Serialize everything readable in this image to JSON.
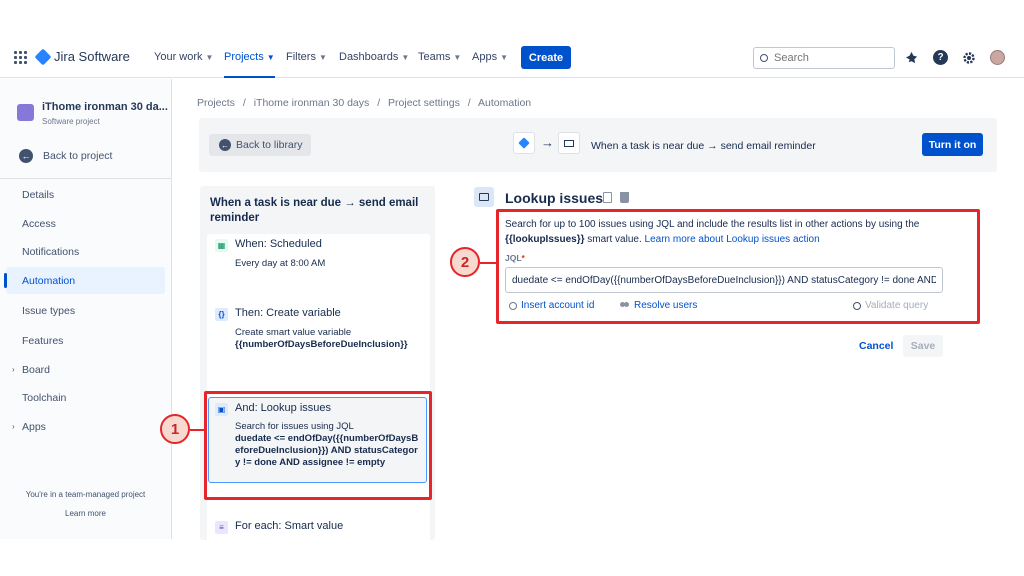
{
  "topnav": {
    "logo": "Jira Software",
    "items": [
      {
        "label": "Your work"
      },
      {
        "label": "Projects"
      },
      {
        "label": "Filters"
      },
      {
        "label": "Dashboards"
      },
      {
        "label": "Teams"
      },
      {
        "label": "Apps"
      }
    ],
    "create_label": "Create",
    "search_placeholder": "Search"
  },
  "sidebar": {
    "project_name": "iThome ironman 30 da...",
    "project_type": "Software project",
    "back_label": "Back to project",
    "items": [
      {
        "label": "Details"
      },
      {
        "label": "Access"
      },
      {
        "label": "Notifications"
      },
      {
        "label": "Automation"
      },
      {
        "label": "Issue types"
      },
      {
        "label": "Features"
      },
      {
        "label": "Board"
      },
      {
        "label": "Toolchain"
      },
      {
        "label": "Apps"
      }
    ],
    "footer_text": "You're in a team-managed project",
    "footer_link": "Learn more"
  },
  "breadcrumb": {
    "items": [
      "Projects",
      "/",
      "iThome ironman 30 days",
      "/",
      "Project settings",
      "/",
      "Automation"
    ]
  },
  "toolbar": {
    "back_label": "Back to library",
    "rule_title": "When a task is near due → send email reminder",
    "turn_on_label": "Turn it on"
  },
  "rule": {
    "title": "When a task is near due → send email reminder",
    "components": [
      {
        "head": "When: Scheduled",
        "desc": "Every day at 8:00 AM"
      },
      {
        "head": "Then: Create variable",
        "desc": "Create smart value variable",
        "desc_bold": "{{numberOfDaysBeforeDueInclusion}}"
      },
      {
        "head": "And: Lookup issues",
        "desc": "Search for issues using JQL",
        "desc_bold": "duedate <= endOfDay({{numberOfDaysBeforeDueInclusion}}) AND statusCategory != done AND assignee != empty"
      },
      {
        "head": "For each: Smart value"
      }
    ]
  },
  "lookup": {
    "title": "Lookup issues",
    "desc_1": "Search for up to 100 issues using JQL and include the results list in other actions by using the",
    "smart_value": "{{lookupIssues}}",
    "desc_2": " smart value. ",
    "learn_more": "Learn more about Lookup issues action",
    "jql_label": "JQL",
    "jql_required": "*",
    "jql_value": "duedate <= endOfDay({{numberOfDaysBeforeDueInclusion}}) AND statusCategory != done AND assignee != empty",
    "insert_account": "Insert account id",
    "resolve_users": "Resolve users",
    "validate_query": "Validate query",
    "cancel_label": "Cancel",
    "save_label": "Save"
  },
  "annotations": {
    "one": "1",
    "two": "2"
  },
  "colors": {
    "brand": "#0052cc",
    "annotation": "#e5252a"
  }
}
